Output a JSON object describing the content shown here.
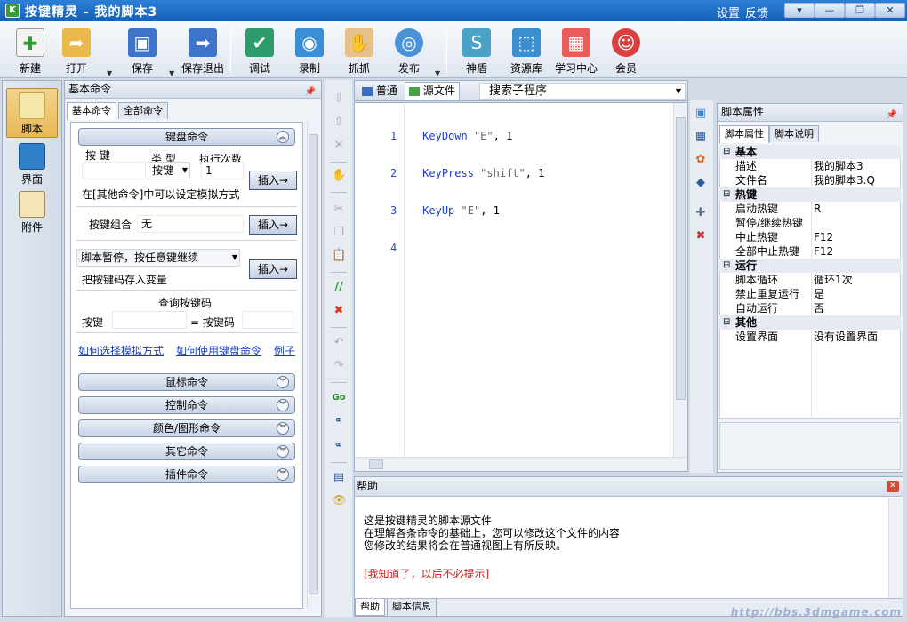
{
  "window": {
    "title": "按键精灵 - 我的脚本3",
    "links": [
      "设置",
      "反馈"
    ],
    "buttons": [
      "▾",
      "—",
      "❐",
      "✕"
    ]
  },
  "toolbar": {
    "items": [
      "新建",
      "打开",
      "保存",
      "保存退出",
      "调试",
      "录制",
      "抓抓",
      "发布",
      "神盾",
      "资源库",
      "学习中心",
      "会员"
    ]
  },
  "leftnav": {
    "items": [
      "脚本",
      "界面",
      "附件"
    ]
  },
  "cmdpanel": {
    "title": "基本命令",
    "tabs": [
      "基本命令",
      "全部命令"
    ],
    "keyboard_group": "键盘命令",
    "label_key": "按 键",
    "label_type": "类 型",
    "label_count": "执行次数",
    "type_value": "按键",
    "count_value": "1",
    "insert": "插入→",
    "hint_other": "在[其他命令]中可以设定模拟方式",
    "combo_label": "按键组合",
    "combo_value": "无",
    "pause_option": "脚本暂停，按任意键继续",
    "store_label": "把按键码存入变量",
    "query_title": "查询按键码",
    "query_key": "按键",
    "query_code": "= 按键码",
    "links": [
      "如何选择模拟方式",
      "如何使用键盘命令",
      "例子"
    ],
    "groups": [
      "鼠标命令",
      "控制命令",
      "颜色/图形命令",
      "其它命令",
      "插件命令"
    ]
  },
  "editor": {
    "tabs": [
      "普通",
      "源文件"
    ],
    "sub_search": "搜索子程序",
    "lines": [
      {
        "n": "1",
        "cmd": "KeyDown",
        "arg": "\"E\"",
        "tail": ", 1"
      },
      {
        "n": "2",
        "cmd": "KeyPress",
        "arg": "\"shift\"",
        "tail": ", 1"
      },
      {
        "n": "3",
        "cmd": "KeyUp",
        "arg": "\"E\"",
        "tail": ", 1"
      },
      {
        "n": "4",
        "cmd": "",
        "arg": "",
        "tail": ""
      }
    ]
  },
  "help": {
    "title": "帮助",
    "lines": [
      "这是按键精灵的脚本源文件",
      "在理解各条命令的基础上，您可以修改这个文件的内容",
      "您修改的结果将会在普通视图上有所反映。"
    ],
    "dismiss": "[我知道了，以后不必提示]",
    "tabs": [
      "帮助",
      "脚本信息"
    ]
  },
  "props": {
    "title": "脚本属性",
    "tabs": [
      "脚本属性",
      "脚本说明"
    ],
    "rows": [
      {
        "cat": true,
        "k": "基本"
      },
      {
        "k": "描述",
        "v": "我的脚本3"
      },
      {
        "k": "文件名",
        "v": "我的脚本3.Q"
      },
      {
        "cat": true,
        "k": "热键"
      },
      {
        "k": "启动热键",
        "v": "R"
      },
      {
        "k": "暂停/继续热键",
        "v": ""
      },
      {
        "k": "中止热键",
        "v": "F12"
      },
      {
        "k": "全部中止热键",
        "v": "F12"
      },
      {
        "cat": true,
        "k": "运行"
      },
      {
        "k": "脚本循环",
        "v": "循环1次"
      },
      {
        "k": "禁止重复运行",
        "v": "是"
      },
      {
        "k": "自动运行",
        "v": "否"
      },
      {
        "cat": true,
        "k": "其他"
      },
      {
        "k": "设置界面",
        "v": "没有设置界面"
      }
    ]
  },
  "watermark": "http://bbs.3dmgame.com"
}
